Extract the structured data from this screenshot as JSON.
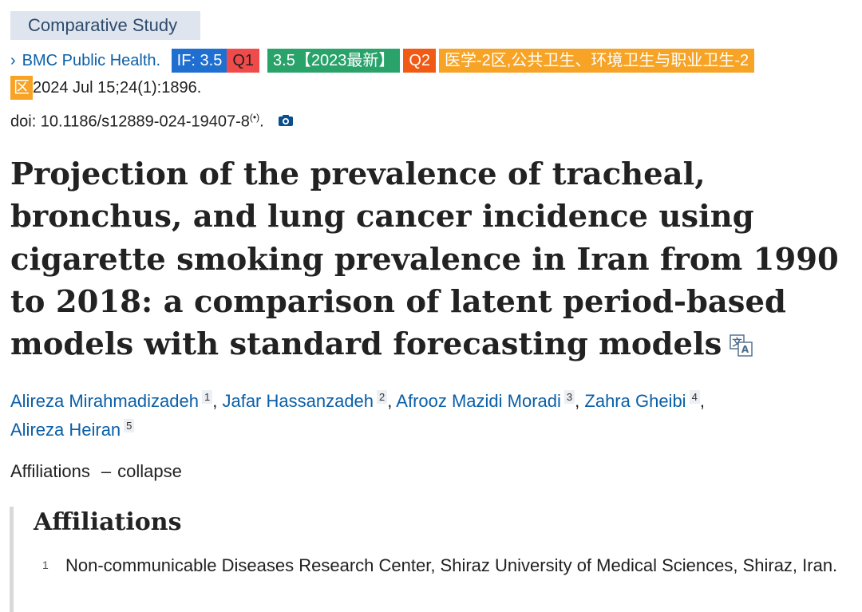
{
  "article_type": "Comparative Study",
  "citation": {
    "journal": "BMC Public Health.",
    "impact_factor": "IF: 3.5",
    "quartile": "Q1",
    "jcr_tag": "3.5【2023最新】",
    "cas_quartile": "Q2",
    "cas_category_part1": "医学-2区,公共卫生、环境卫生与职业卫生-2",
    "cas_category_part2": "区",
    "date_volume": "2024 Jul 15;24(1):1896.",
    "doi_label": "doi: 10.1186/s12889-024-19407-8",
    "doi_signal": "(•)",
    "doi_period": "."
  },
  "title": "Projection of the prevalence of tracheal, bronchus, and lung cancer incidence using cigarette smoking prevalence in Iran from 1990 to 2018: a comparison of latent period-based models with standard forecasting models",
  "authors": [
    {
      "name": "Alireza Mirahmadizadeh",
      "aff": "1",
      "sep": ", "
    },
    {
      "name": "Jafar Hassanzadeh",
      "aff": "2",
      "sep": ", "
    },
    {
      "name": "Afrooz Mazidi Moradi",
      "aff": "3",
      "sep": ", "
    },
    {
      "name": "Zahra Gheibi",
      "aff": "4",
      "sep": ","
    },
    {
      "name": "Alireza Heiran",
      "aff": "5",
      "sep": ""
    }
  ],
  "affiliations_toggle": {
    "label": "Affiliations",
    "dash": "–",
    "action": "collapse"
  },
  "affiliations": {
    "heading": "Affiliations",
    "items": [
      {
        "num": "1",
        "text": "Non-communicable Diseases Research Center, Shiraz University of Medical Sciences, Shiraz, Iran."
      }
    ]
  },
  "icons": {
    "chevron": "chevron-right-icon",
    "camera": "camera-icon",
    "translate": "translate-icon"
  },
  "colors": {
    "link": "#0a5fa8",
    "if_tag": "#1f6fd1",
    "q1_tag": "#f04a4a",
    "jcr_tag": "#2aa36b",
    "q2_tag": "#f05a14",
    "cas_tag": "#f7a325",
    "type_badge_bg": "#dfe5ee"
  }
}
